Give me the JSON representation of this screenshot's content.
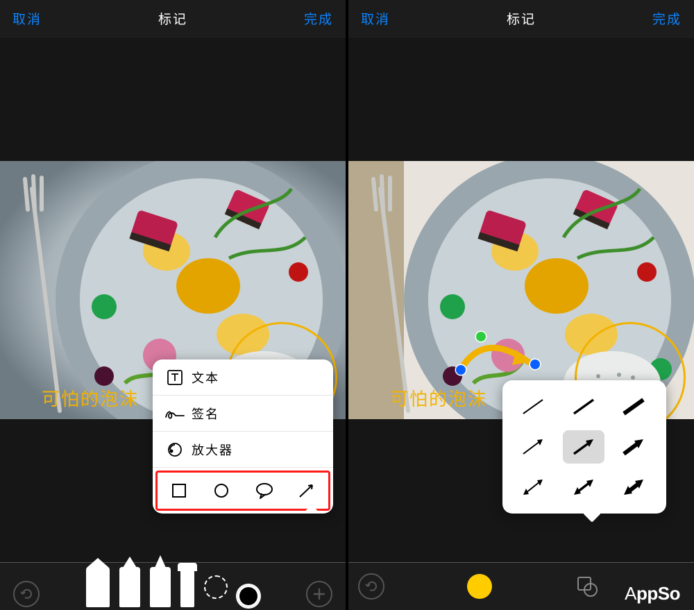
{
  "nav": {
    "cancel": "取消",
    "title": "标记",
    "done": "完成"
  },
  "annotation_label": "可怕的泡沫",
  "add_menu": {
    "text": "文本",
    "signature": "签名",
    "magnifier": "放大器"
  },
  "brand": "AppSo",
  "accent_color": "#0a84ff",
  "highlight_color": "#f2b200"
}
